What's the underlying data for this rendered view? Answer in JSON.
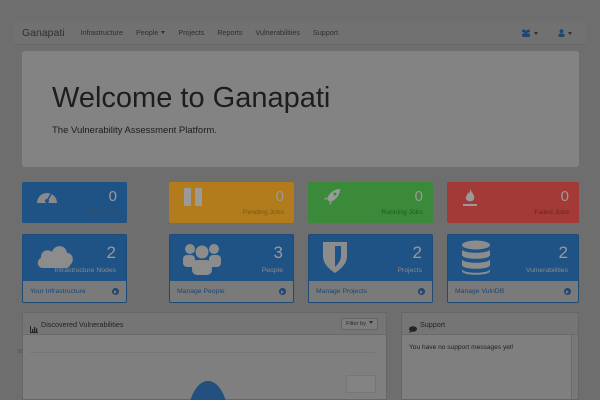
{
  "navbar": {
    "brand": "Ganapati",
    "items": [
      "Infrastructure",
      "People",
      "Projects",
      "Reports",
      "Vulnerabilities",
      "Support"
    ]
  },
  "jumbotron": {
    "title": "Welcome to Ganapati",
    "subtitle": "The Vulnerability Assessment Platform."
  },
  "stats": [
    {
      "value": "0",
      "label": "Spool Size",
      "icon": "dashboard-icon",
      "color": "#1f5386"
    },
    {
      "value": "0",
      "label": "Pending Jobs",
      "icon": "pause-icon",
      "color": "#b27b1c"
    },
    {
      "value": "0",
      "label": "Running Jobs",
      "icon": "rocket-icon",
      "color": "#3a8a3a"
    },
    {
      "value": "0",
      "label": "Failed Jobs",
      "icon": "fire-icon",
      "color": "#a33a37"
    }
  ],
  "cards": [
    {
      "value": "2",
      "label": "Infrastructure Nodes",
      "link": "Your Infrastructure",
      "icon": "cloud-icon"
    },
    {
      "value": "3",
      "label": "People",
      "link": "Manage People",
      "icon": "users-icon"
    },
    {
      "value": "2",
      "label": "Projects",
      "link": "Manage Projects",
      "icon": "shield-icon"
    },
    {
      "value": "2",
      "label": "Vulnerabilities",
      "link": "Manage VulnDB",
      "icon": "database-icon"
    }
  ],
  "vuln_panel": {
    "title": "Discovered Vulnerabilities",
    "filter_label": "Filter by",
    "tick": "30"
  },
  "support_panel": {
    "title": "Support",
    "message": "You have no support messages yet!"
  }
}
